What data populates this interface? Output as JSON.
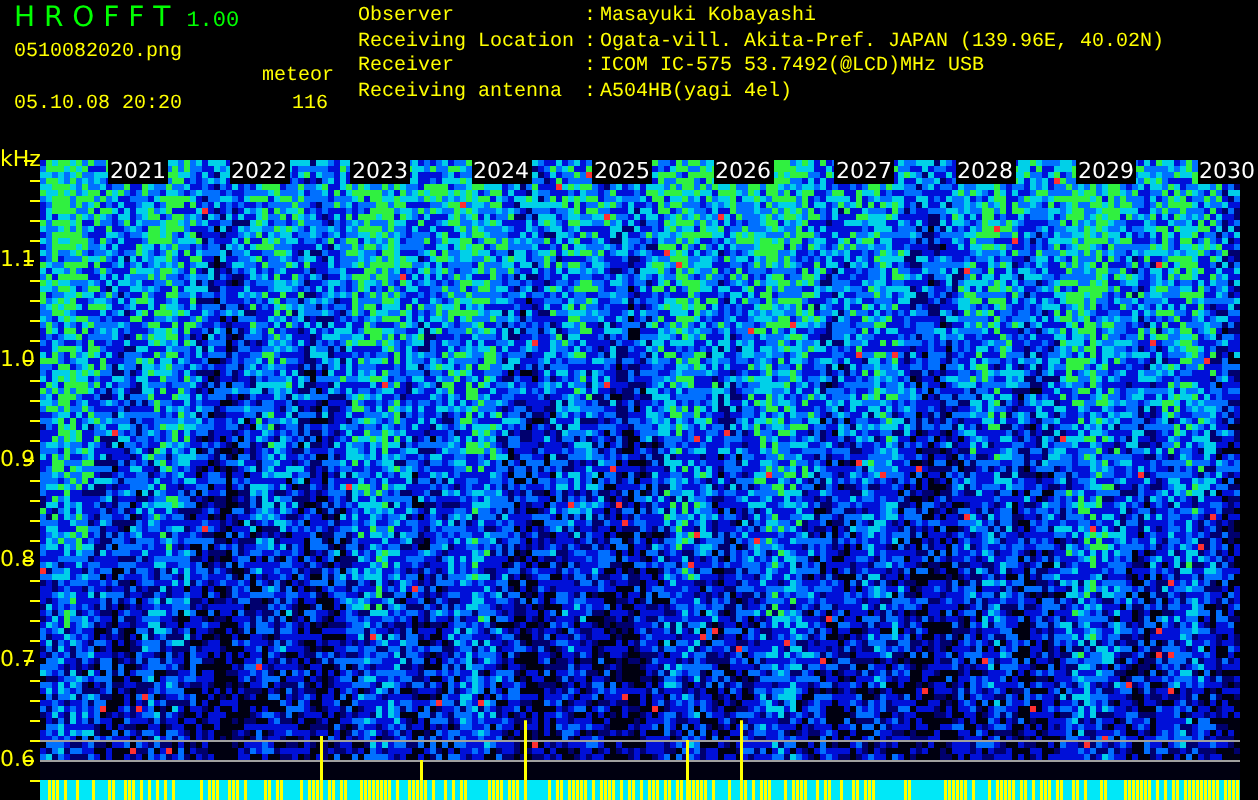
{
  "app": {
    "title": "H R O F F T",
    "version": "1.00"
  },
  "file": {
    "name": "0510082020.png",
    "datetime": "05.10.08 20:20"
  },
  "meteor": {
    "label": "meteor",
    "count": "116"
  },
  "station": [
    {
      "label": "Observer",
      "separator": ":",
      "value": "Masayuki Kobayashi"
    },
    {
      "label": "Receiving Location",
      "separator": ":",
      "value": "Ogata-vill. Akita-Pref. JAPAN (139.96E, 40.02N)"
    },
    {
      "label": "Receiver",
      "separator": ":",
      "value": "ICOM IC-575 53.7492(@LCD)MHz USB"
    },
    {
      "label": "Receiving antenna",
      "separator": ":",
      "value": "A504HB(yagi 4el)"
    }
  ],
  "spectrogram": {
    "y_unit": "kHz",
    "y_labels": [
      "1.1",
      "1.0",
      "0.9",
      "0.8",
      "0.7",
      "0.6"
    ],
    "time_labels": [
      "2021",
      "2022",
      "2023",
      "2024",
      "2025",
      "2026",
      "2027",
      "2028",
      "2029",
      "2030"
    ]
  }
}
